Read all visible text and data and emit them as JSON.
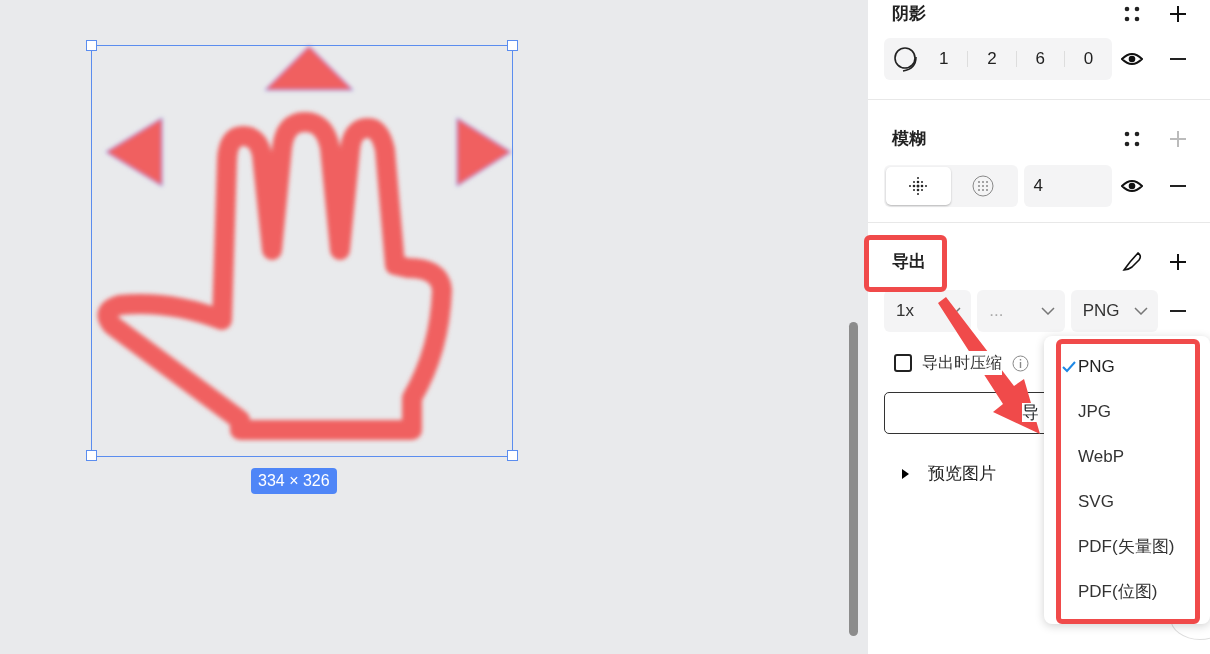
{
  "canvas": {
    "selection_size": "334 × 326"
  },
  "shadow": {
    "title": "阴影",
    "values": [
      "1",
      "2",
      "6",
      "0"
    ],
    "visible": true,
    "add_disabled": false
  },
  "blur": {
    "title": "模糊",
    "modes": [
      {
        "selected": true
      },
      {
        "selected": false
      }
    ],
    "value": "4",
    "visible": true,
    "add_disabled": true
  },
  "export": {
    "title": "导出",
    "scale": "1x",
    "suffix_placeholder": "...",
    "format": "PNG",
    "compress": {
      "label": "导出时压缩",
      "checked": false
    },
    "button": "导",
    "preview": {
      "label": "预览图片",
      "expanded": false
    }
  },
  "format_menu": {
    "options": [
      {
        "label": "PNG",
        "selected": true
      },
      {
        "label": "JPG",
        "selected": false
      },
      {
        "label": "WebP",
        "selected": false
      },
      {
        "label": "SVG",
        "selected": false
      },
      {
        "label": "PDF(矢量图)",
        "selected": false
      },
      {
        "label": "PDF(位图)",
        "selected": false
      }
    ]
  }
}
